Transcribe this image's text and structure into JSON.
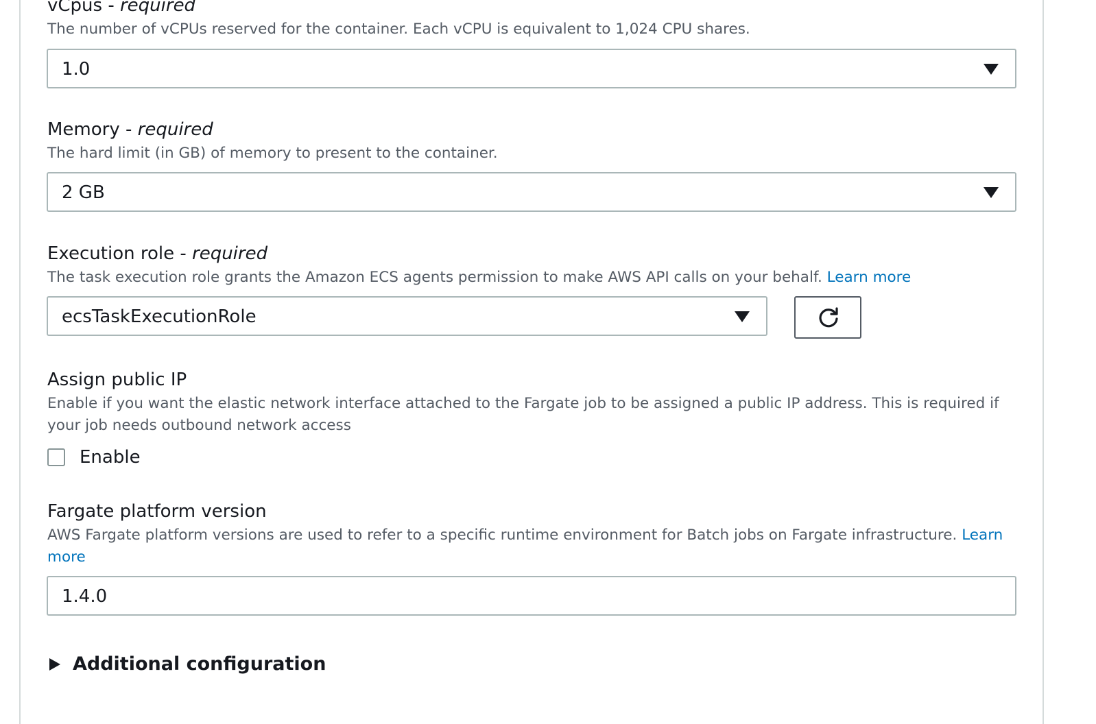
{
  "vcpus": {
    "label": "vCpus -",
    "required": "required",
    "description": "The number of vCPUs reserved for the container. Each vCPU is equivalent to 1,024 CPU shares.",
    "value": "1.0"
  },
  "memory": {
    "label": "Memory -",
    "required": "required",
    "description": "The hard limit (in GB) of memory to present to the container.",
    "value": "2 GB"
  },
  "execution_role": {
    "label": "Execution role -",
    "required": "required",
    "description": "The task execution role grants the Amazon ECS agents permission to make AWS API calls on your behalf.",
    "link": "Learn more",
    "value": "ecsTaskExecutionRole",
    "refresh_icon": "refresh-icon"
  },
  "public_ip": {
    "label": "Assign public IP",
    "description": "Enable if you want the elastic network interface attached to the Fargate job to be assigned a public IP address. This is required if your job needs outbound network access",
    "checkbox_label": "Enable",
    "checked": false
  },
  "platform_version": {
    "label": "Fargate platform version",
    "description": "AWS Fargate platform versions are used to refer to a specific runtime environment for Batch jobs on Fargate infrastructure.",
    "link": "Learn more",
    "value": "1.4.0"
  },
  "additional": {
    "label": "Additional configuration"
  },
  "colors": {
    "link": "#0073bb",
    "text": "#16191f",
    "muted": "#545b64",
    "border": "#aab7b8"
  }
}
